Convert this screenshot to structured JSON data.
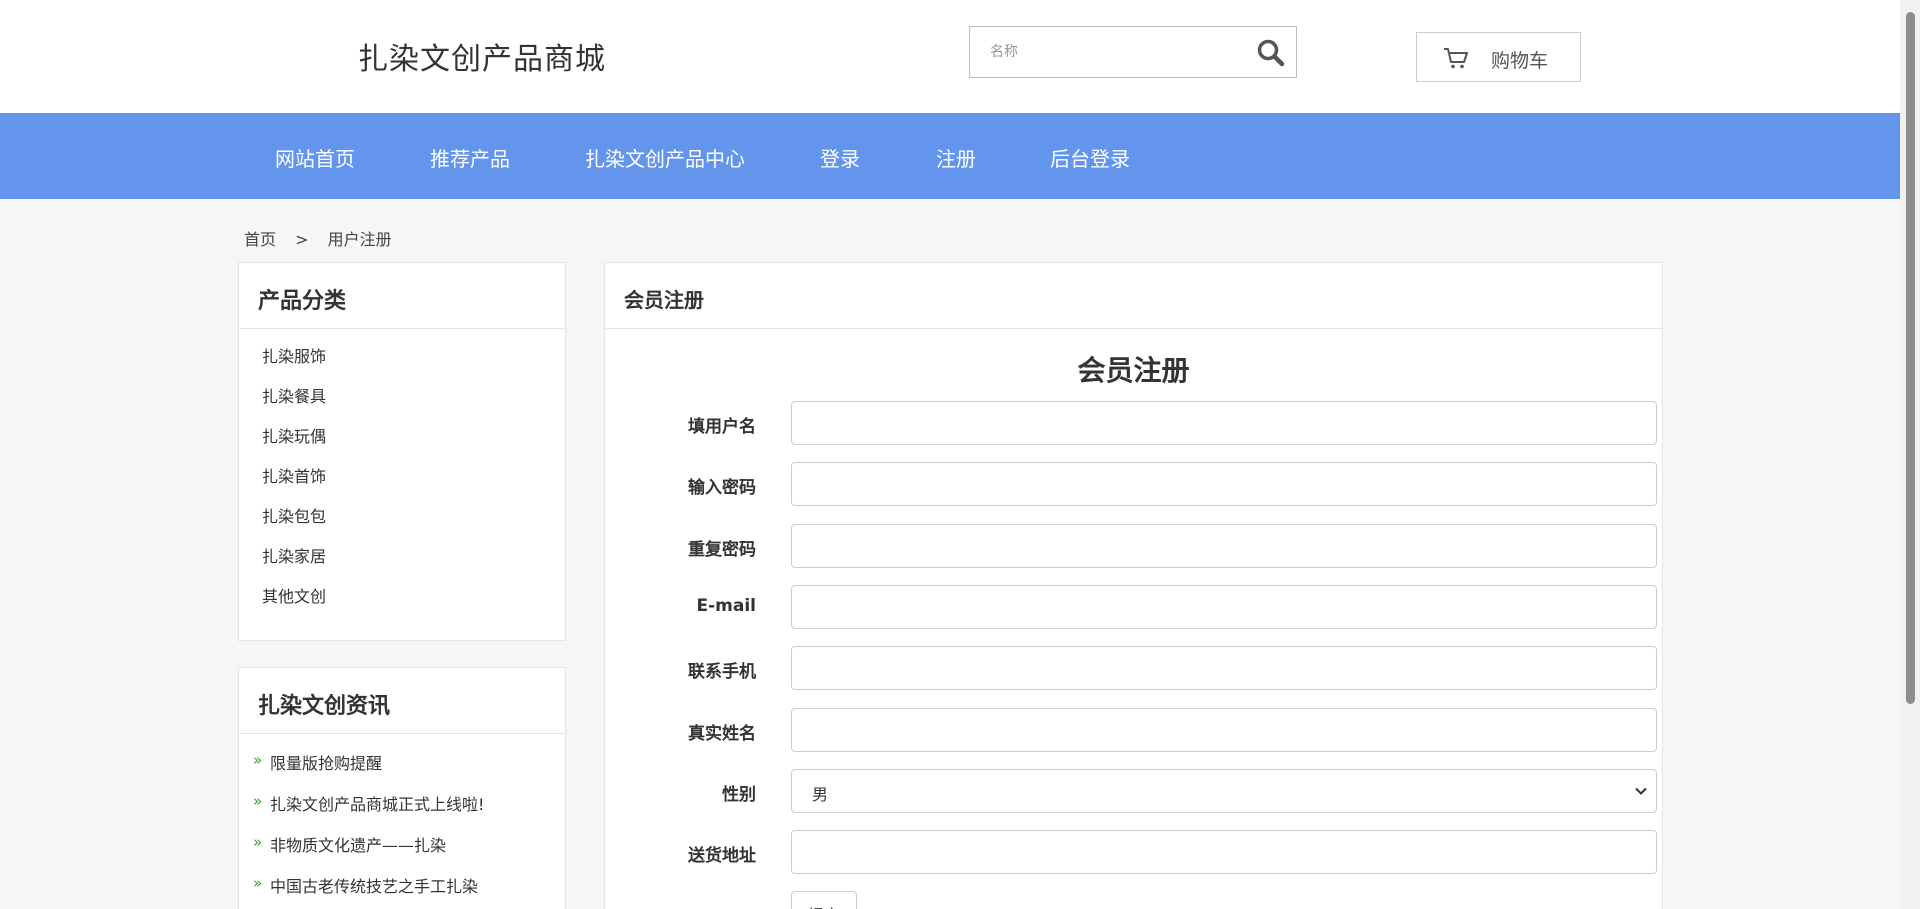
{
  "header": {
    "title": "扎染文创产品商城",
    "search_placeholder": "名称",
    "cart_label": "购物车"
  },
  "nav": {
    "items": [
      "网站首页",
      "推荐产品",
      "扎染文创产品中心",
      "登录",
      "注册",
      "后台登录"
    ]
  },
  "breadcrumb": {
    "home": "首页",
    "separator": ">",
    "current": "用户注册"
  },
  "categories": {
    "title": "产品分类",
    "items": [
      "扎染服饰",
      "扎染餐具",
      "扎染玩偶",
      "扎染首饰",
      "扎染包包",
      "扎染家居",
      "其他文创"
    ]
  },
  "news": {
    "title": "扎染文创资讯",
    "bullet": "»",
    "items": [
      "限量版抢购提醒",
      "扎染文创产品商城正式上线啦!",
      "非物质文化遗产——扎染",
      "中国古老传统技艺之手工扎染"
    ]
  },
  "register": {
    "panel_title": "会员注册",
    "form_title": "会员注册",
    "fields": {
      "username": "填用户名",
      "password": "输入密码",
      "repeat_password": "重复密码",
      "email": "E-mail",
      "phone": "联系手机",
      "real_name": "真实姓名",
      "gender": "性别",
      "address": "送货地址"
    },
    "gender_selected": "男",
    "submit_label": "提交"
  }
}
